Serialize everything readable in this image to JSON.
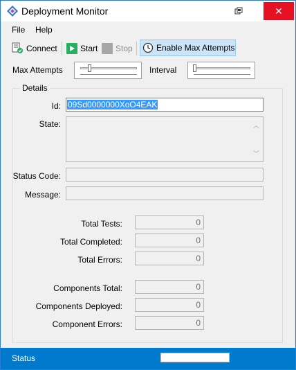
{
  "window": {
    "title": "Deployment Monitor",
    "close_glyph": "✕"
  },
  "menu": [
    "File",
    "Help"
  ],
  "toolbar": {
    "connect": "Connect",
    "start": "Start",
    "stop": "Stop",
    "enable_max_attempts": "Enable Max Attempts"
  },
  "sliders": {
    "max_attempts_label": "Max Attempts",
    "interval_label": "Interval"
  },
  "details": {
    "group_title": "Details",
    "id_label": "Id:",
    "id_value": "09Sd0000000XoO4EAK",
    "state_label": "State:",
    "state_value": "",
    "status_code_label": "Status Code:",
    "status_code_value": "",
    "message_label": "Message:",
    "message_value": ""
  },
  "stats": [
    {
      "label": "Total Tests:",
      "value": "0"
    },
    {
      "label": "Total Completed:",
      "value": "0"
    },
    {
      "label": "Total Errors:",
      "value": "0"
    },
    {
      "label": "Components Total:",
      "value": "0"
    },
    {
      "label": "Components Deployed:",
      "value": "0"
    },
    {
      "label": "Component Errors:",
      "value": "0"
    }
  ],
  "status_bar": {
    "text": "Status"
  },
  "colors": {
    "accent": "#007acc",
    "selection": "#3399ff",
    "close": "#e81123",
    "start_green": "#27ae60"
  }
}
